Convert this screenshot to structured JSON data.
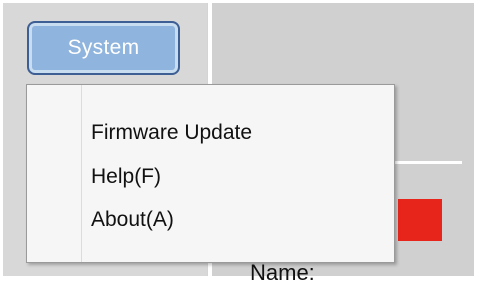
{
  "toolbar": {
    "system_label": "System"
  },
  "system_menu": {
    "items": [
      {
        "label": "Firmware Update"
      },
      {
        "label": "Help(F)"
      },
      {
        "label": "About(A)"
      }
    ]
  },
  "form": {
    "name_label": "Name:"
  },
  "colors": {
    "button_fill": "#8fb4dd",
    "button_border": "#3e5f93",
    "status_red": "#e8251b",
    "menu_background": "#f6f6f6"
  }
}
